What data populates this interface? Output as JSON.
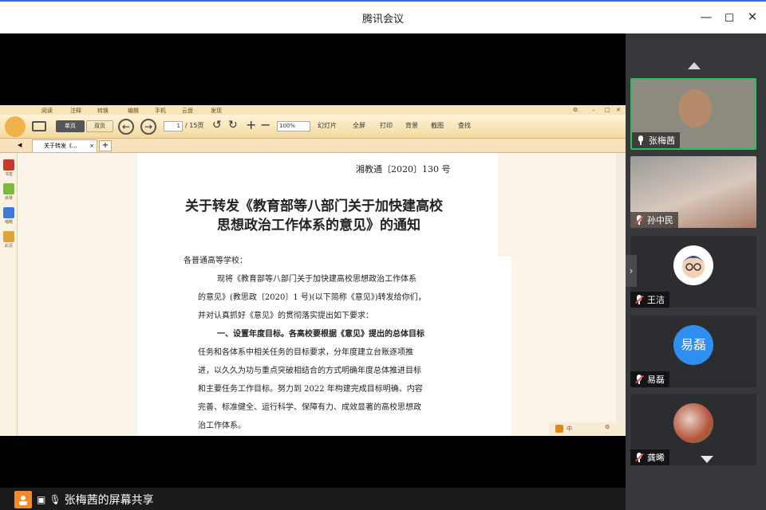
{
  "window": {
    "title": "腾讯会议"
  },
  "doc_viewer": {
    "menu_items": [
      "阅读",
      "注释",
      "转换",
      "编辑",
      "手机",
      "云盘",
      "发现"
    ],
    "toolbar": {
      "single_page": "单页",
      "double_page": "双页",
      "page_current": "1",
      "page_total": "/ 15页",
      "zoom": "100%",
      "slideshow": "幻灯片",
      "fullscreen": "全屏",
      "print": "打印",
      "bg": "背景",
      "capture": "截图",
      "find": "查找"
    },
    "tab_label": "关于转发《...",
    "left_rail": [
      "书签",
      "目录",
      "缩略",
      "彩页"
    ],
    "bottom_status": "中"
  },
  "document": {
    "doc_number": "湘教通〔2020〕130 号",
    "title_line1": "关于转发《教育部等八部门关于加快建高校",
    "title_line2": "思想政治工作体系的意见》的通知",
    "salutation": "各普通高等学校：",
    "para1_line1": "现将《教育部等八部门关于加快建高校思想政治工作体系",
    "para1_line2": "的意见》(教思政〔2020〕1 号)(以下简称《意见》)转发给你们，",
    "para1_line3": "并对认真抓好《意见》的贯彻落实提出如下要求：",
    "para2_line1": "一、设置年度目标。各高校要根据《意见》提出的总体目标",
    "para2_line2": "任务和各体系中相关任务的目标要求，分年度建立台账逐项推",
    "para2_line3": "进，以久久为功与重点突破相结合的方式明确年度总体推进目标",
    "para2_line4": "和主要任务工作目标。努力到 2022 年构建完成目标明确、内容",
    "para2_line5": "完善、标准健全、运行科学、保障有力、成效显著的高校思想政",
    "para2_line6": "治工作体系。"
  },
  "participants": [
    {
      "name": "张梅茜",
      "avatar_text": ""
    },
    {
      "name": "孙中民",
      "avatar_text": ""
    },
    {
      "name": "王洁",
      "avatar_text": ""
    },
    {
      "name": "易磊",
      "avatar_text": "易磊"
    },
    {
      "name": "龚晞",
      "avatar_text": ""
    }
  ],
  "presenter_label": "张梅茜的屏幕共享",
  "colors": {
    "accent": "#2b6fd8",
    "avatar_blue": "#2f8ff0",
    "presenter_orange": "#f08a2e",
    "viewer_orange": "#f0b24a"
  }
}
